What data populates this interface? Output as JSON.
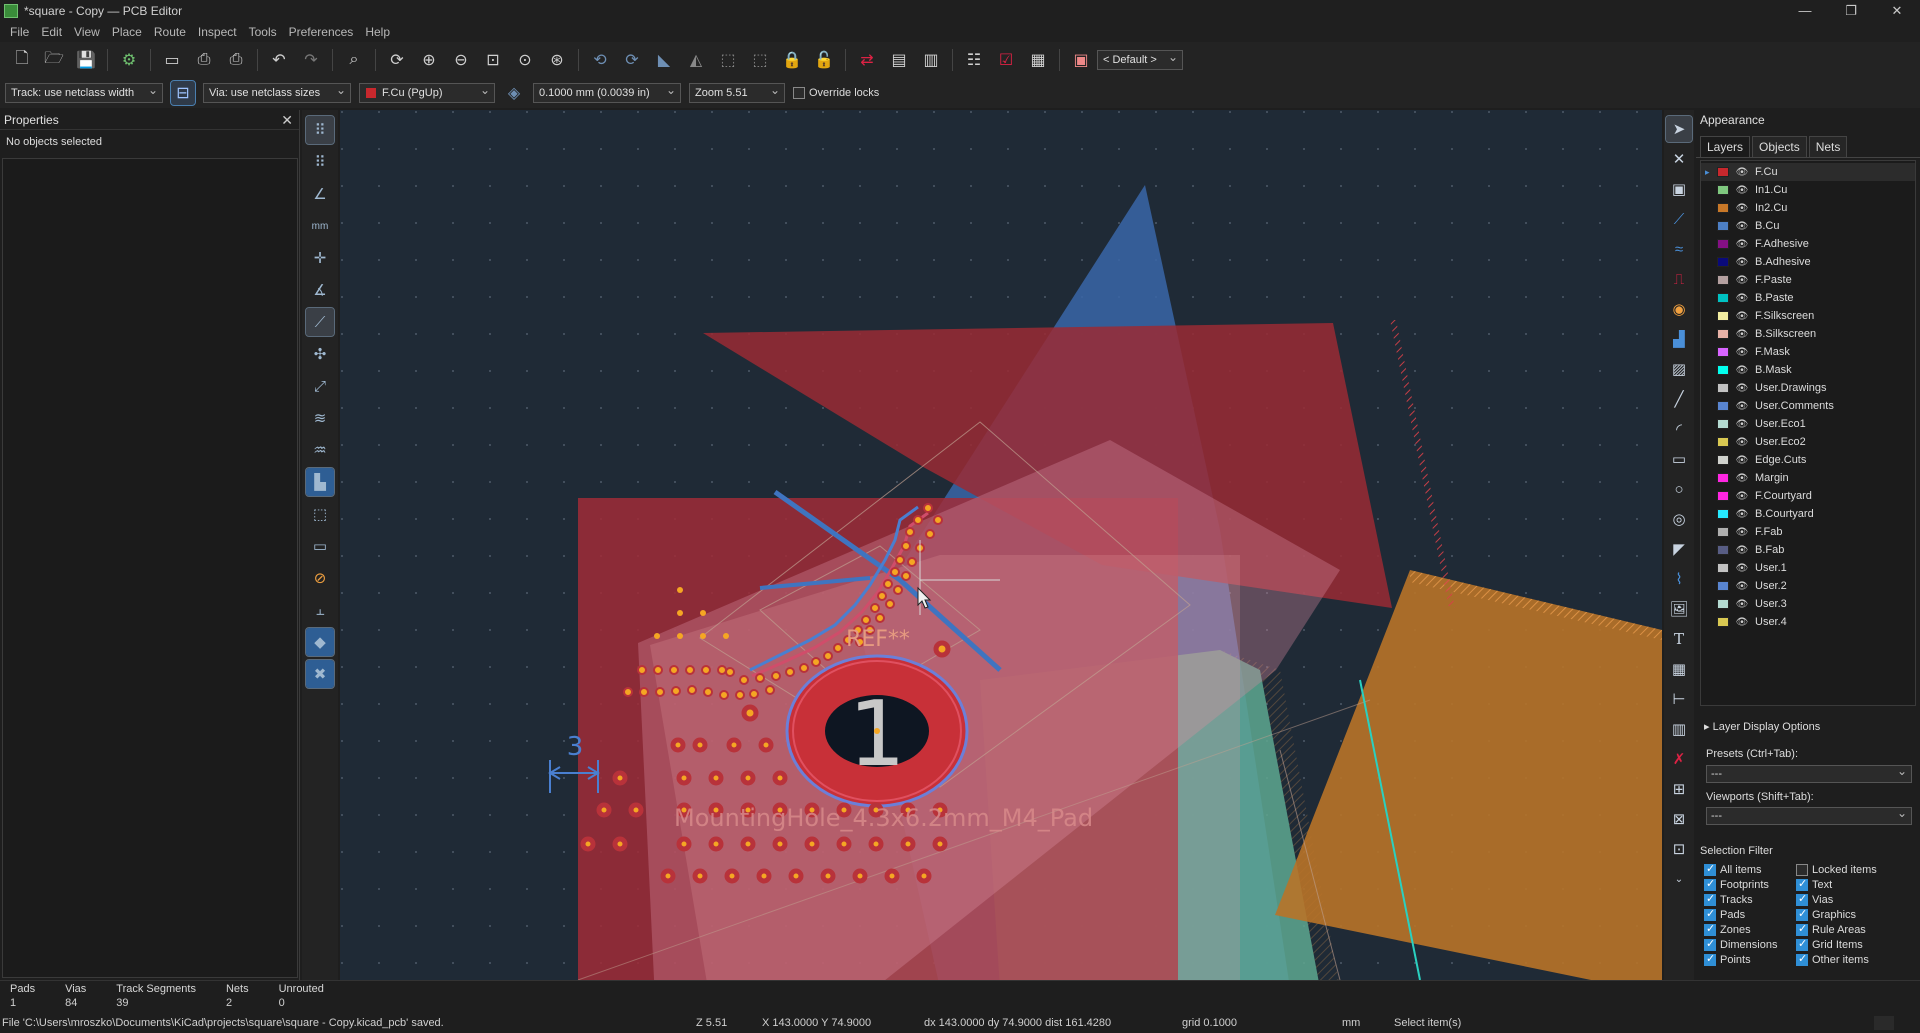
{
  "window": {
    "title": "*square - Copy — PCB Editor",
    "controls": [
      "—",
      "❐",
      "✕"
    ]
  },
  "menu": [
    "File",
    "Edit",
    "View",
    "Place",
    "Route",
    "Inspect",
    "Tools",
    "Preferences",
    "Help"
  ],
  "toolbar": {
    "viewport_preset": "< Default >",
    "track_width": "Track: use netclass width",
    "via_size": "Via: use netclass sizes",
    "layer": "F.Cu (PgUp)",
    "grid": "0.1000 mm (0.0039 in)",
    "zoom": "Zoom 5.51",
    "override_locks": "Override locks",
    "layer_color": "#c8282d"
  },
  "properties": {
    "title": "Properties",
    "close": "✕",
    "empty_message": "No objects selected"
  },
  "canvas": {
    "ref_text": "REF**",
    "pad_number": "1",
    "footprint_value": "MountingHole_4.3x6.2mm_M4_Pad",
    "dimension_text": "3"
  },
  "appearance": {
    "title": "Appearance",
    "tabs": [
      "Layers",
      "Objects",
      "Nets"
    ],
    "layers": [
      {
        "name": "F.Cu",
        "color": "#c8282d"
      },
      {
        "name": "In1.Cu",
        "color": "#7fc87f"
      },
      {
        "name": "In2.Cu",
        "color": "#c87828"
      },
      {
        "name": "B.Cu",
        "color": "#4d7fc4"
      },
      {
        "name": "F.Adhesive",
        "color": "#841084"
      },
      {
        "name": "B.Adhesive",
        "color": "#0a0a7a"
      },
      {
        "name": "F.Paste",
        "color": "#b4a0a0"
      },
      {
        "name": "B.Paste",
        "color": "#00c2c2"
      },
      {
        "name": "F.Silkscreen",
        "color": "#f2eda1"
      },
      {
        "name": "B.Silkscreen",
        "color": "#e8b2a7"
      },
      {
        "name": "F.Mask",
        "color": "#d864ff"
      },
      {
        "name": "B.Mask",
        "color": "#02ffee"
      },
      {
        "name": "User.Drawings",
        "color": "#c2c2c2"
      },
      {
        "name": "User.Comments",
        "color": "#5985d0"
      },
      {
        "name": "User.Eco1",
        "color": "#b4dbd2"
      },
      {
        "name": "User.Eco2",
        "color": "#d8c852"
      },
      {
        "name": "Edge.Cuts",
        "color": "#d0d2cd"
      },
      {
        "name": "Margin",
        "color": "#ff26e2"
      },
      {
        "name": "F.Courtyard",
        "color": "#ff26e2"
      },
      {
        "name": "B.Courtyard",
        "color": "#26e9ff"
      },
      {
        "name": "F.Fab",
        "color": "#afafaf"
      },
      {
        "name": "B.Fab",
        "color": "#585d84"
      },
      {
        "name": "User.1",
        "color": "#c2c2c2"
      },
      {
        "name": "User.2",
        "color": "#5985d0"
      },
      {
        "name": "User.3",
        "color": "#b4dbd2"
      },
      {
        "name": "User.4",
        "color": "#d8c852"
      }
    ],
    "layer_display_options": "Layer Display Options",
    "presets_label": "Presets (Ctrl+Tab):",
    "presets_value": "---",
    "viewports_label": "Viewports (Shift+Tab):",
    "viewports_value": "---",
    "selection_filter_title": "Selection Filter",
    "selection_filter": [
      {
        "label": "All items",
        "checked": true
      },
      {
        "label": "Locked items",
        "checked": false
      },
      {
        "label": "Footprints",
        "checked": true
      },
      {
        "label": "Text",
        "checked": true
      },
      {
        "label": "Tracks",
        "checked": true
      },
      {
        "label": "Vias",
        "checked": true
      },
      {
        "label": "Pads",
        "checked": true
      },
      {
        "label": "Graphics",
        "checked": true
      },
      {
        "label": "Zones",
        "checked": true
      },
      {
        "label": "Rule Areas",
        "checked": true
      },
      {
        "label": "Dimensions",
        "checked": true
      },
      {
        "label": "Grid Items",
        "checked": true
      },
      {
        "label": "Points",
        "checked": true
      },
      {
        "label": "Other items",
        "checked": true
      }
    ]
  },
  "stats": [
    {
      "label": "Pads",
      "value": "1"
    },
    {
      "label": "Vias",
      "value": "84"
    },
    {
      "label": "Track Segments",
      "value": "39"
    },
    {
      "label": "Nets",
      "value": "2"
    },
    {
      "label": "Unrouted",
      "value": "0"
    }
  ],
  "status": {
    "message": "File 'C:\\Users\\mroszko\\Documents\\KiCad\\projects\\square\\square - Copy.kicad_pcb' saved.",
    "zoom": "Z 5.51",
    "coords": "X 143.0000  Y 74.9000",
    "delta": "dx 143.0000  dy 74.9000  dist 161.4280",
    "grid": "grid 0.1000",
    "units": "mm",
    "mode": "Select item(s)"
  }
}
